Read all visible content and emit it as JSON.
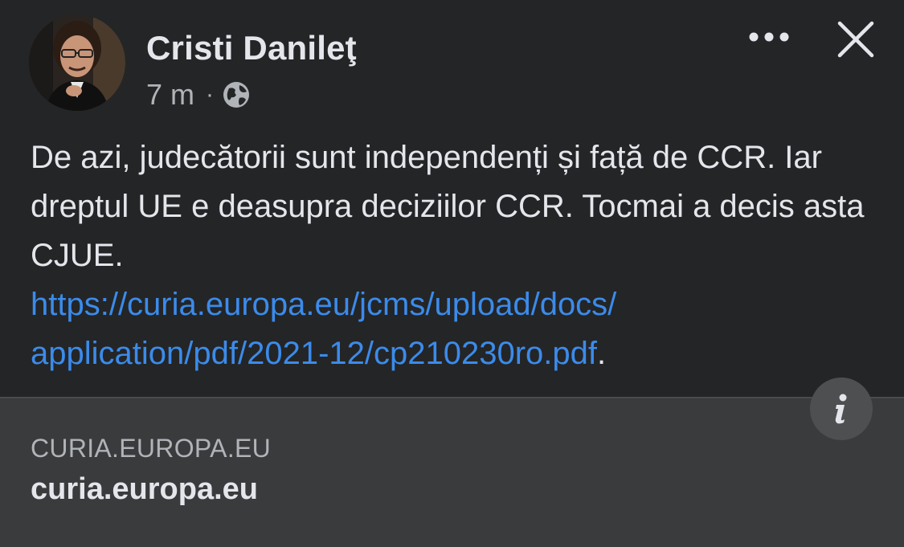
{
  "post": {
    "author": "Cristi Danileţ",
    "time": "7 m",
    "separator": "·",
    "text_before_link": "De azi, judecătorii sunt independenți și față de CCR. Iar dreptul UE e deasupra deciziilor CCR. Tocmai a decis asta CJUE.",
    "link_line1": "https://curia.europa.eu/jcms/upload/docs/",
    "link_line2": "application/pdf/2021-12/cp210230ro.pdf",
    "text_after_link": "."
  },
  "link_preview": {
    "domain": "CURIA.EUROPA.EU",
    "title": "curia.europa.eu"
  },
  "icons": {
    "globe": "globe-icon",
    "more": "more-horizontal-icon",
    "close": "close-icon",
    "info": "info-icon"
  },
  "colors": {
    "background": "#242526",
    "text": "#e4e6eb",
    "secondary_text": "#b0b3b8",
    "link": "#3b8beb",
    "card_background": "#3a3b3c"
  }
}
